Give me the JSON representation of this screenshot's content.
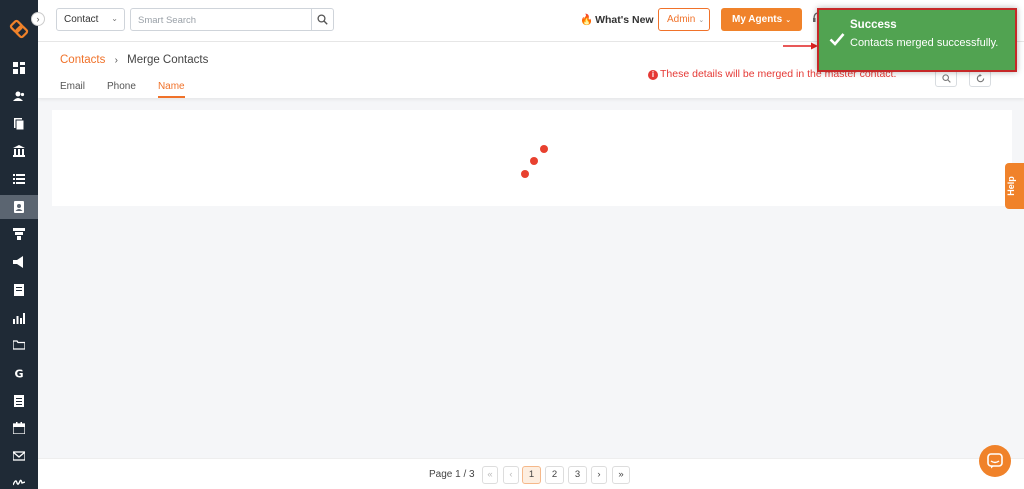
{
  "topbar": {
    "entity_select": "Contact",
    "search_placeholder": "Smart Search",
    "whats_new": "What's New",
    "admin_label": "Admin",
    "agents_label": "My Agents"
  },
  "breadcrumb": {
    "parent": "Contacts",
    "current": "Merge Contacts"
  },
  "tabs": [
    "Email",
    "Phone",
    "Name"
  ],
  "active_tab": "Name",
  "notice": "These details will be merged in the master contact.",
  "toast": {
    "title": "Success",
    "message": "Contacts merged successfully."
  },
  "pagination": {
    "info": "Page 1 / 3",
    "first": "«",
    "prev": "‹",
    "pages": [
      "1",
      "2",
      "3"
    ],
    "current_page": "1",
    "next": "›",
    "last": "»"
  },
  "help_label": "Help",
  "colors": {
    "accent": "#f0822a",
    "sidebar": "#1f2a36",
    "toast_bg": "#51a351",
    "error": "#e53935"
  },
  "sidebar_icons": [
    "dashboard-icon",
    "users-icon",
    "documents-icon",
    "bank-icon",
    "list-icon",
    "contacts-icon",
    "funnel-icon",
    "megaphone-icon",
    "report-icon",
    "chart-icon",
    "folder-icon",
    "google-icon",
    "spreadsheet-icon",
    "calendar-icon",
    "mail-icon",
    "signature-icon"
  ]
}
